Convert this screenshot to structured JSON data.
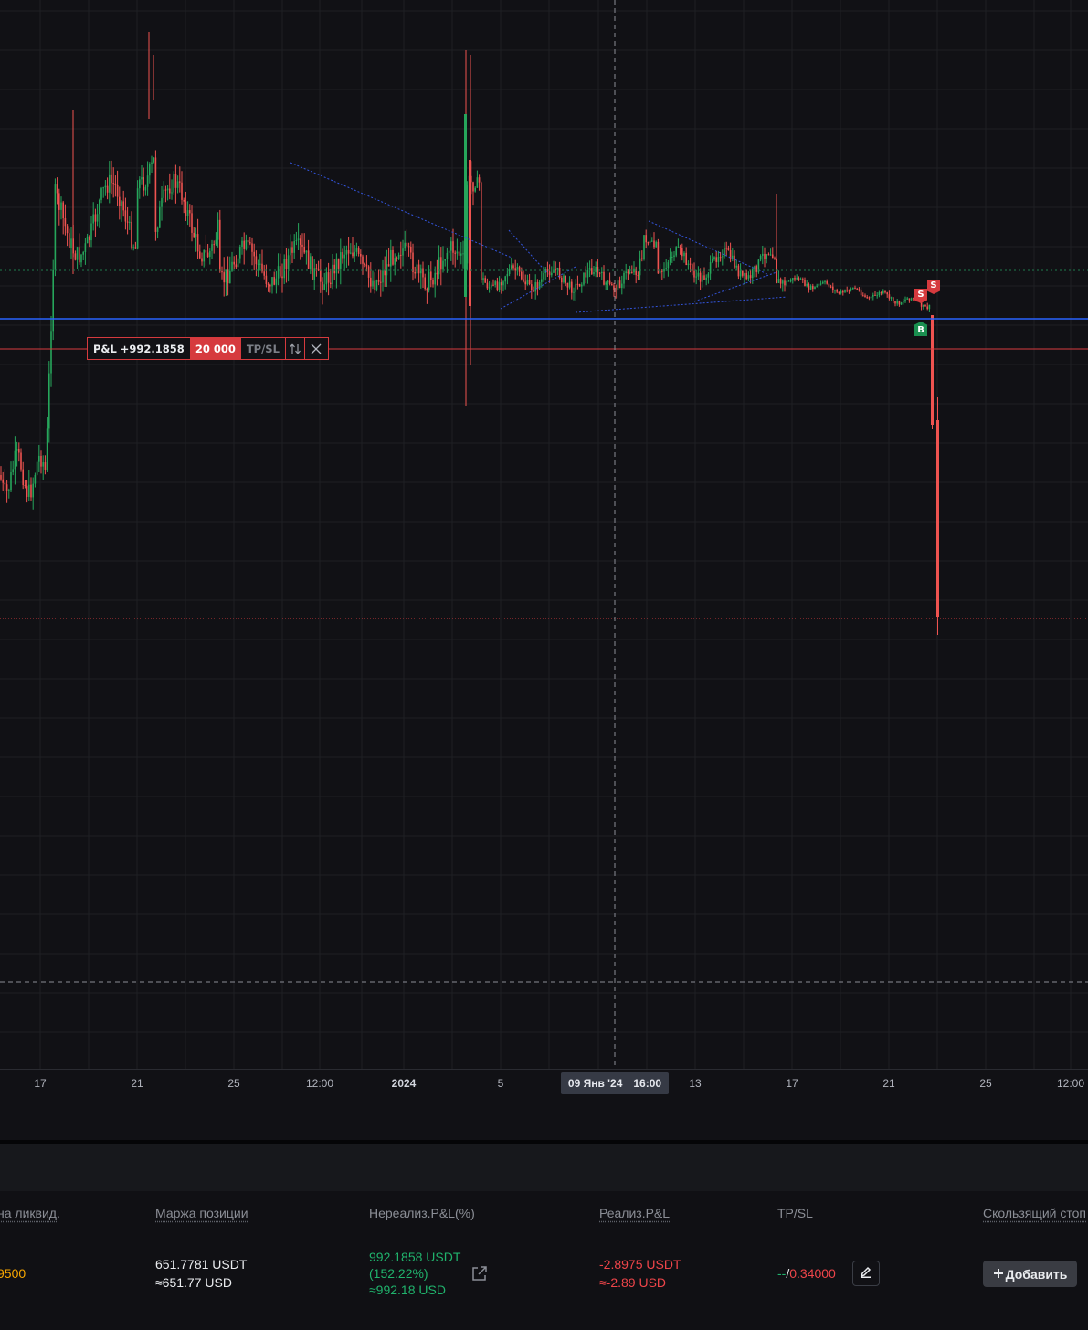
{
  "colors": {
    "background": "#111115",
    "grid": "#1e1f24",
    "candle_up": "#26a65b",
    "candle_down": "#ef5350",
    "entry_line": "#2962ff",
    "position_line": "#d63a3e",
    "liquidation_line": "#d63a3e",
    "trend_lines": "#3355dd"
  },
  "time_axis": {
    "ticks": [
      {
        "label": "17",
        "bold": false
      },
      {
        "label": "21",
        "bold": false
      },
      {
        "label": "25",
        "bold": false
      },
      {
        "label": "12:00",
        "bold": false
      },
      {
        "label": "2024",
        "bold": true
      },
      {
        "label": "5",
        "bold": false
      },
      {
        "label": "13",
        "bold": false
      },
      {
        "label": "17",
        "bold": false
      },
      {
        "label": "21",
        "bold": false
      },
      {
        "label": "25",
        "bold": false
      },
      {
        "label": "12:00",
        "bold": false
      }
    ],
    "crosshair_date": "09 Янв '24",
    "crosshair_time": "16:00"
  },
  "position_label": {
    "pnl": "P&L +992.1858",
    "quantity": "20 000",
    "tpsl": "TP/SL",
    "reverse_icon": "reverse-arrows-icon",
    "close_icon": "close-icon"
  },
  "trade_markers": [
    {
      "side": "sell",
      "text": "S"
    },
    {
      "side": "sell",
      "text": "S"
    },
    {
      "side": "buy",
      "text": "B"
    }
  ],
  "positions_table": {
    "headers": {
      "liq_price": "на ликвид.",
      "margin": "Маржа позиции",
      "unrealized": "Нереализ.P&L(%)",
      "realized": "Реализ.P&L",
      "tpsl": "TP/SL",
      "trailing": "Скользящий стоп"
    },
    "row": {
      "liq_price": "9500",
      "margin_line1": "651.7781 USDT",
      "margin_line2": "≈651.77 USD",
      "unrealized_line1": "992.1858 USDT",
      "unrealized_line2": "(152.22%)",
      "unrealized_line3": "≈992.18 USD",
      "realized_line1": "-2.8975 USDT",
      "realized_line2": "≈-2.89 USD",
      "tp_value": "--",
      "tpsl_separator": "/",
      "sl_value": "0.34000",
      "add_button": "Добавить",
      "add_icon": "plus-icon",
      "edit_icon": "pencil-icon",
      "share_icon": "share-icon"
    }
  }
}
